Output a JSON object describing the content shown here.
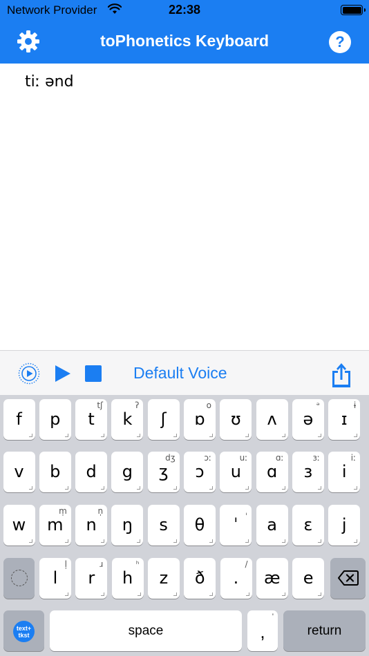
{
  "status_bar": {
    "carrier": "Network Provider",
    "time": "22:38"
  },
  "nav": {
    "title": "toPhonetics Keyboard",
    "help_label": "?"
  },
  "editor": {
    "text": "tiː ənd"
  },
  "toolbar": {
    "voice_label": "Default Voice"
  },
  "keyboard": {
    "rows": [
      [
        {
          "key": "f",
          "alt": ""
        },
        {
          "key": "p",
          "alt": ""
        },
        {
          "key": "t",
          "alt": "tʃ"
        },
        {
          "key": "k",
          "alt": "ʔ"
        },
        {
          "key": "ʃ",
          "alt": ""
        },
        {
          "key": "ɒ",
          "alt": "o"
        },
        {
          "key": "ʊ",
          "alt": ""
        },
        {
          "key": "ʌ",
          "alt": ""
        },
        {
          "key": "ə",
          "alt": "ᵊ"
        },
        {
          "key": "ɪ",
          "alt": "ɨ"
        }
      ],
      [
        {
          "key": "v",
          "alt": ""
        },
        {
          "key": "b",
          "alt": ""
        },
        {
          "key": "d",
          "alt": ""
        },
        {
          "key": "g",
          "alt": ""
        },
        {
          "key": "ʒ",
          "alt": "dʒ"
        },
        {
          "key": "ɔ",
          "alt": "ɔː"
        },
        {
          "key": "u",
          "alt": "uː"
        },
        {
          "key": "ɑ",
          "alt": "ɑː"
        },
        {
          "key": "ɜ",
          "alt": "ɜː"
        },
        {
          "key": "i",
          "alt": "iː"
        }
      ],
      [
        {
          "key": "w",
          "alt": ""
        },
        {
          "key": "m",
          "alt": "m̩"
        },
        {
          "key": "n",
          "alt": "n̩"
        },
        {
          "key": "ŋ",
          "alt": ""
        },
        {
          "key": "s",
          "alt": ""
        },
        {
          "key": "θ",
          "alt": ""
        },
        {
          "key": "ˈ",
          "alt": "ˌ"
        },
        {
          "key": "a",
          "alt": ""
        },
        {
          "key": "ɛ",
          "alt": ""
        },
        {
          "key": "j",
          "alt": ""
        }
      ],
      [
        {
          "key": "l",
          "alt": "l̩"
        },
        {
          "key": "r",
          "alt": "ɹ"
        },
        {
          "key": "h",
          "alt": "ʰ"
        },
        {
          "key": "z",
          "alt": ""
        },
        {
          "key": "ð",
          "alt": ""
        },
        {
          "key": ".",
          "alt": "/"
        },
        {
          "key": "æ",
          "alt": ""
        },
        {
          "key": "e",
          "alt": ""
        }
      ]
    ],
    "space_label": "space",
    "comma_key": ",",
    "comma_alt": "'",
    "return_label": "return",
    "brand_logo_text": "text+ tkst"
  },
  "colors": {
    "accent": "#1b7ef2",
    "keyboard_bg": "#d1d3d9",
    "key_dark": "#abb0ba"
  }
}
